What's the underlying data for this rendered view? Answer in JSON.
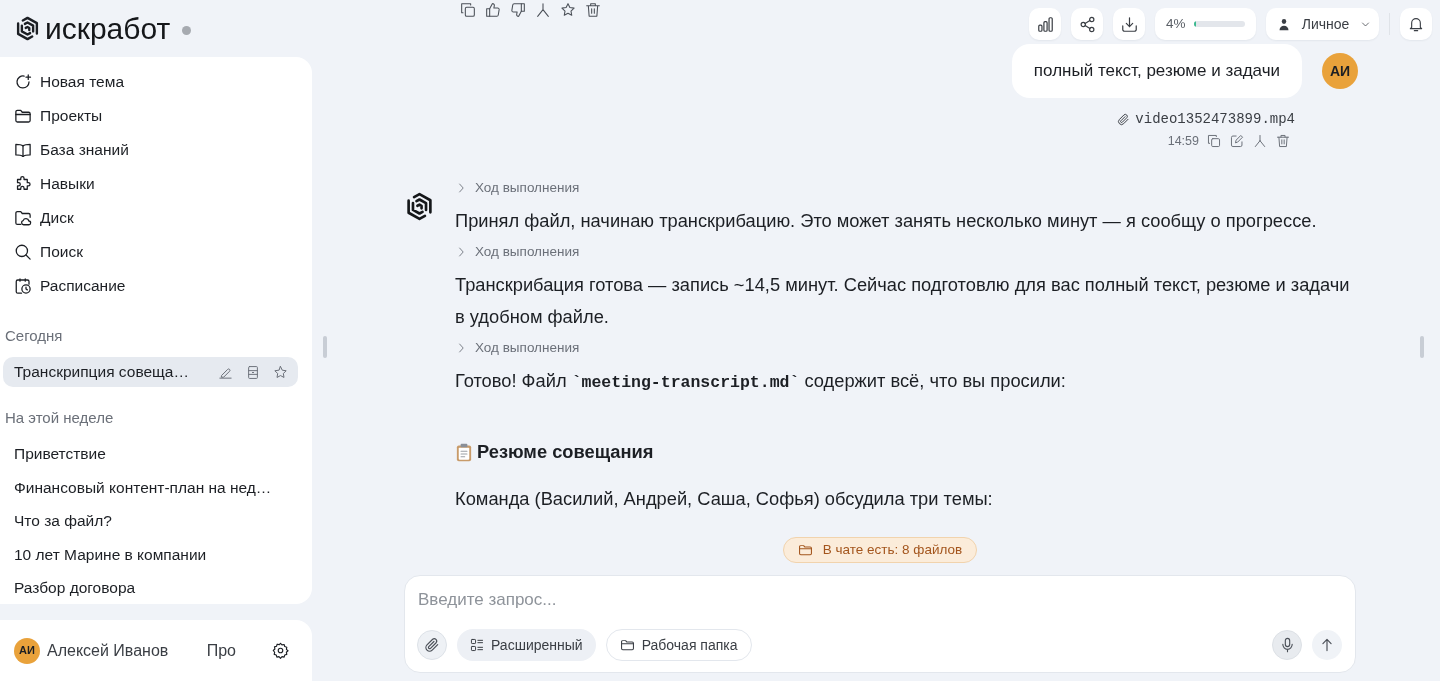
{
  "sidebar": {
    "logo": "искработ",
    "nav": [
      {
        "label": "Новая тема"
      },
      {
        "label": "Проекты"
      },
      {
        "label": "База знаний"
      },
      {
        "label": "Навыки"
      },
      {
        "label": "Диск"
      },
      {
        "label": "Поиск"
      },
      {
        "label": "Расписание"
      }
    ],
    "history": [
      {
        "heading": "Сегодня",
        "items": [
          {
            "title": "Транскрипция совеща…",
            "selected": true
          }
        ]
      },
      {
        "heading": "На этой неделе",
        "items": [
          {
            "title": "Приветствие",
            "selected": false
          },
          {
            "title": "Финансовый контент-план на нед…",
            "selected": false
          },
          {
            "title": "Что за файл?",
            "selected": false
          },
          {
            "title": "10 лет Марине в компании",
            "selected": false
          },
          {
            "title": "Разбор договора",
            "selected": false
          }
        ]
      }
    ],
    "user": {
      "initials": "АИ",
      "name": "Алексей Иванов",
      "plan": "Про"
    }
  },
  "toolbar": {
    "usage": {
      "reading": "4%",
      "level": 0.04
    },
    "workspace": "Личное"
  },
  "chat": {
    "user_message": {
      "text": "полный текст, резюме и задачи",
      "initials": "АИ",
      "attachment": "video1352473899.mp4",
      "time": "14:59"
    },
    "assistant_blocks": [
      {
        "kind": "progress",
        "label": "Ход выполнения",
        "expanded": false
      },
      {
        "kind": "paragraph",
        "parts": [
          {
            "kind": "text",
            "text": "Принял файл, начинаю транскрибацию. Это может занять несколько минут — я сообщу о прогрессе."
          }
        ]
      },
      {
        "kind": "progress",
        "label": "Ход выполнения",
        "expanded": false
      },
      {
        "kind": "paragraph",
        "parts": [
          {
            "kind": "text",
            "text": "Транскрибация готова — запись ~14,5 минут. Сейчас подготовлю для вас полный текст, резюме и задачи в удобном файле."
          }
        ]
      },
      {
        "kind": "progress",
        "label": "Ход выполнения",
        "expanded": false
      },
      {
        "kind": "paragraph",
        "parts": [
          {
            "kind": "text",
            "text": "Готово! Файл "
          },
          {
            "kind": "code",
            "text": "`meeting-transcript.md`"
          },
          {
            "kind": "text",
            "text": " содержит всё, что вы просили:"
          }
        ]
      },
      {
        "kind": "heading",
        "text": "Резюме совещания"
      },
      {
        "kind": "paragraph",
        "parts": [
          {
            "kind": "text",
            "text": "Команда (Василий, Андрей, Саша, Софья) обсудила три темы:"
          }
        ]
      }
    ]
  },
  "files_notice": "В чате есть: 8 файлов",
  "composer": {
    "placeholder": "Введите запрос...",
    "buttons": [
      {
        "kind": "mode",
        "label": "Расширенный"
      },
      {
        "kind": "folder",
        "label": "Рабочая папка"
      }
    ]
  }
}
